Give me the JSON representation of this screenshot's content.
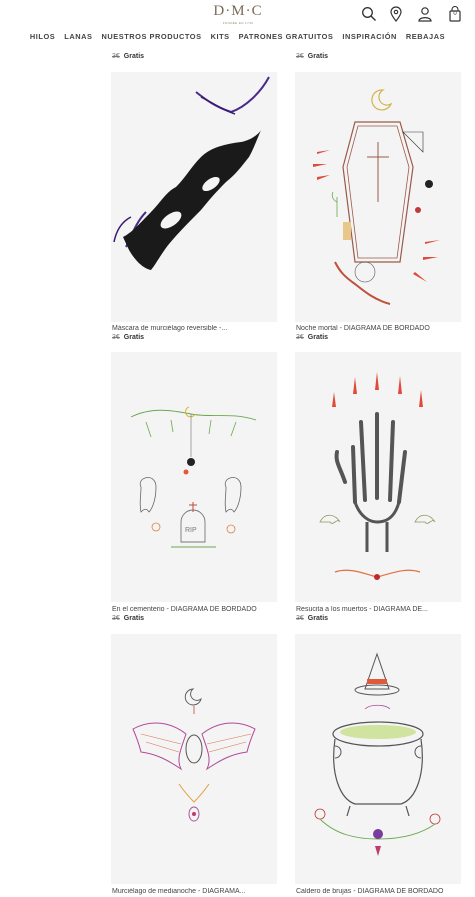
{
  "brand": {
    "name": "D·M·C",
    "tagline": "FONDÉE EN 1746"
  },
  "header": {
    "icons": [
      "search-icon",
      "location-icon",
      "account-icon",
      "cart-icon"
    ],
    "cart_count": "0"
  },
  "nav": {
    "items": [
      "HILOS",
      "LANAS",
      "NUESTROS PRODUCTOS",
      "KITS",
      "PATRONES GRATUITOS",
      "INSPIRACIÓN",
      "REBAJAS"
    ]
  },
  "top_prices": [
    {
      "old": "3€",
      "new": "Gratis"
    },
    {
      "old": "3€",
      "new": "Gratis"
    }
  ],
  "products": [
    {
      "name": "Máscara de murciélago reversible -...",
      "old_price": "3€",
      "price": "Gratis"
    },
    {
      "name": "Noche mortal - DIAGRAMA DE BORDADO",
      "old_price": "3€",
      "price": "Gratis"
    },
    {
      "name": "En el cementerio - DIAGRAMA DE BORDADO",
      "old_price": "3€",
      "price": "Gratis"
    },
    {
      "name": "Resucita a los muertos - DIAGRAMA DE...",
      "old_price": "3€",
      "price": "Gratis"
    },
    {
      "name": "Murciélago de medianoche - DIAGRAMA...",
      "old_price": "",
      "price": ""
    },
    {
      "name": "Caldero de brujas - DIAGRAMA DE BORDADO",
      "old_price": "",
      "price": ""
    }
  ],
  "colors": {
    "logo": "#7b6a58",
    "text": "#333333",
    "card_bg": "#f4f4f4"
  }
}
